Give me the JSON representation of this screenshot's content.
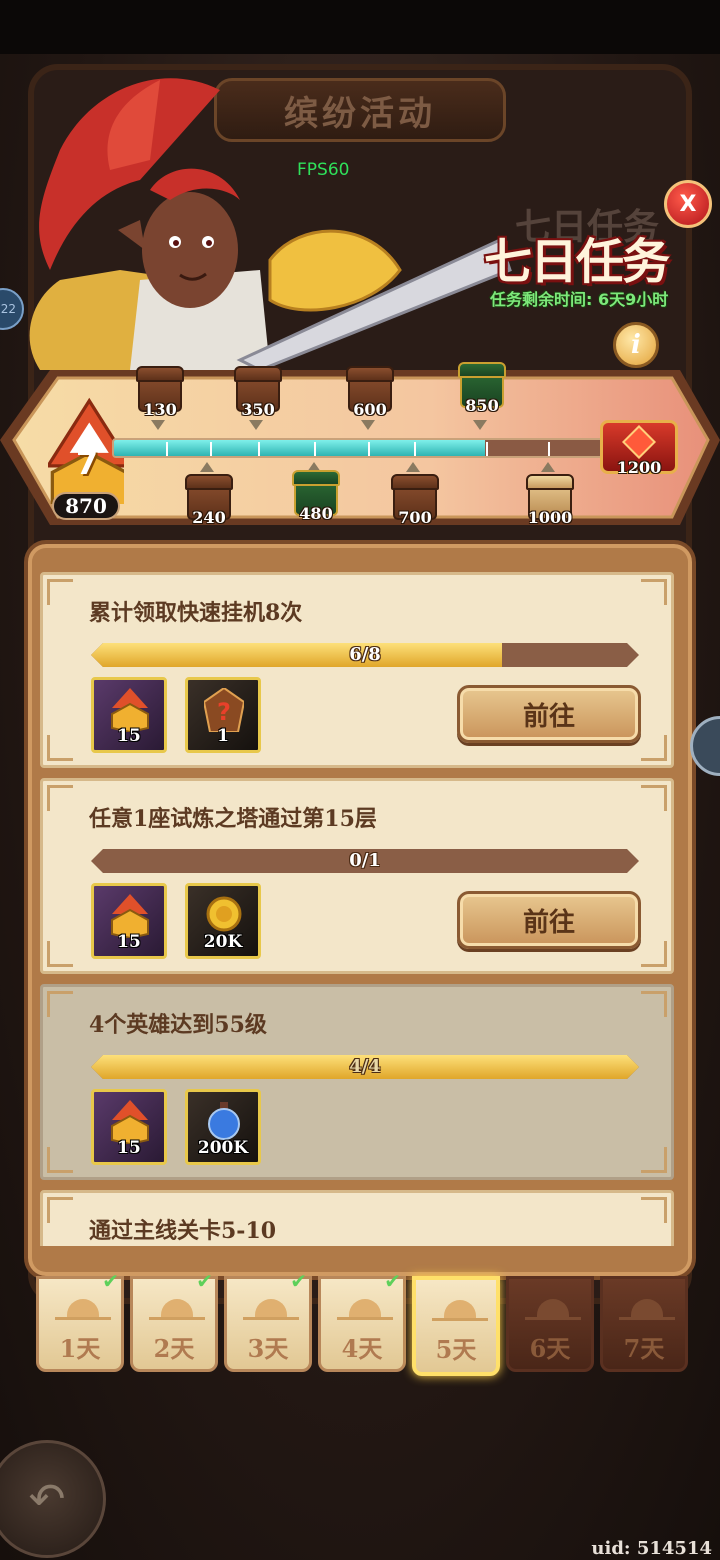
{
  "header": {
    "title": "缤纷活动",
    "fps": "FPS60"
  },
  "event": {
    "title": "七日任务",
    "title_ghost": "七日任务",
    "time_left": "任务剩余时间: 6天9小时",
    "close_icon": "close-icon",
    "info_icon": "info-icon",
    "close_glyph": "X",
    "info_glyph": "i"
  },
  "progress": {
    "level": "7",
    "points": "870",
    "fill_fraction": 0.76,
    "top_chests": [
      {
        "label": "130",
        "kind": "wood"
      },
      {
        "label": "350",
        "kind": "wood"
      },
      {
        "label": "600",
        "kind": "wood"
      },
      {
        "label": "850",
        "kind": "green"
      }
    ],
    "bottom_chests": [
      {
        "label": "240",
        "kind": "wood"
      },
      {
        "label": "480",
        "kind": "green"
      },
      {
        "label": "700",
        "kind": "wood"
      },
      {
        "label": "1000",
        "kind": "gold"
      }
    ],
    "final_chest": "1200"
  },
  "tasks": [
    {
      "title": "累计领取快速挂机8次",
      "progress_text": "6/8",
      "progress": 0.75,
      "rewards": [
        {
          "icon": "level-medal-icon",
          "qty": "15",
          "style": "purple"
        },
        {
          "icon": "mystery-hero-icon",
          "qty": "1",
          "style": "dark"
        }
      ],
      "button": "前往",
      "done": false
    },
    {
      "title": "任意1座试炼之塔通过第15层",
      "progress_text": "0/1",
      "progress": 0,
      "rewards": [
        {
          "icon": "level-medal-icon",
          "qty": "15",
          "style": "purple"
        },
        {
          "icon": "gold-coin-icon",
          "qty": "20K",
          "style": "dark"
        }
      ],
      "button": "前往",
      "done": false
    },
    {
      "title": "4个英雄达到55级",
      "progress_text": "4/4",
      "progress": 1,
      "rewards": [
        {
          "icon": "level-medal-icon",
          "qty": "15",
          "style": "purple"
        },
        {
          "icon": "exp-potion-icon",
          "qty": "200K",
          "style": "dark"
        }
      ],
      "button": "",
      "done": true
    },
    {
      "title": "通过主线关卡5-10",
      "progress_text": "",
      "progress": 0,
      "rewards": [],
      "button": "",
      "done": false
    }
  ],
  "days": [
    {
      "label": "1天",
      "state": "completed"
    },
    {
      "label": "2天",
      "state": "completed"
    },
    {
      "label": "3天",
      "state": "completed"
    },
    {
      "label": "4天",
      "state": "completed"
    },
    {
      "label": "5天",
      "state": "selected"
    },
    {
      "label": "6天",
      "state": "locked"
    },
    {
      "label": "7天",
      "state": "locked"
    }
  ],
  "check_glyph": "✔",
  "back_icon": "back-arrow-icon",
  "back_glyph": "↶",
  "left_badge": "22",
  "uid": "uid: 514514",
  "colors": {
    "accent_gold": "#e0a62a",
    "track_teal": "#2fb4b2",
    "title_red": "#7a1010",
    "time_green": "#7de87a"
  }
}
